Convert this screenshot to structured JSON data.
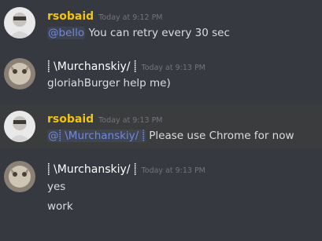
{
  "messages": [
    {
      "author": "rsobaid",
      "timestamp": "Today at 9:12 PM",
      "mention": "@bello",
      "text": "You can retry every 30 sec"
    },
    {
      "author": "⸽ \\Murchanskiy/ ⸽",
      "timestamp": "Today at 9:13 PM",
      "text": "gloriahBurger help me)"
    },
    {
      "author": "rsobaid",
      "timestamp": "Today at 9:13 PM",
      "mention": "@⸽ \\Murchanskiy/ ⸽",
      "text": "Please use Chrome for now"
    },
    {
      "author": "⸽ \\Murchanskiy/ ⸽",
      "timestamp": "Today at 9:13 PM",
      "lines": [
        "yes",
        "work"
      ]
    }
  ],
  "colors": {
    "background": "#36393f",
    "highlight": "#3a3c3d",
    "gold_name": "#f1c40f",
    "mention": "#7289da",
    "timestamp": "#72767d"
  }
}
